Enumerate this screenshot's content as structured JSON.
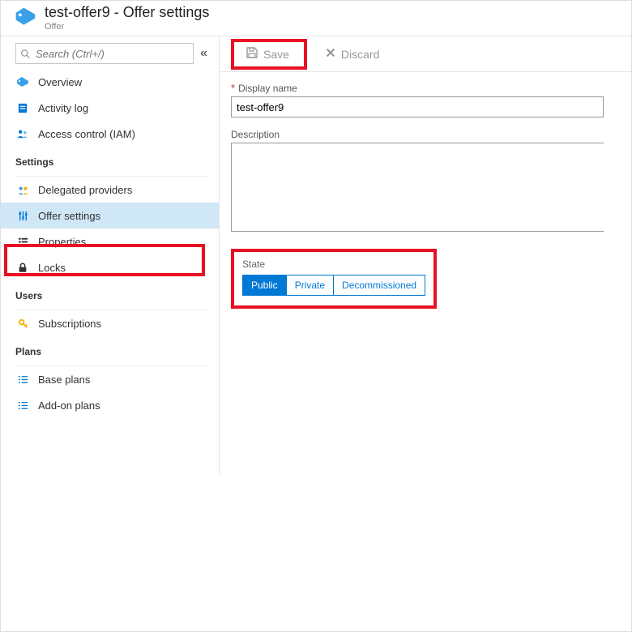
{
  "header": {
    "title": "test-offer9 - Offer settings",
    "subtitle": "Offer"
  },
  "search": {
    "placeholder": "Search (Ctrl+/)"
  },
  "nav": {
    "top": [
      {
        "label": "Overview"
      },
      {
        "label": "Activity log"
      },
      {
        "label": "Access control (IAM)"
      }
    ],
    "settings_label": "Settings",
    "settings": [
      {
        "label": "Delegated providers"
      },
      {
        "label": "Offer settings"
      },
      {
        "label": "Properties"
      },
      {
        "label": "Locks"
      }
    ],
    "users_label": "Users",
    "users": [
      {
        "label": "Subscriptions"
      }
    ],
    "plans_label": "Plans",
    "plans": [
      {
        "label": "Base plans"
      },
      {
        "label": "Add-on plans"
      }
    ]
  },
  "toolbar": {
    "save_label": "Save",
    "discard_label": "Discard"
  },
  "form": {
    "display_name_label": "Display name",
    "display_name_value": "test-offer9",
    "description_label": "Description",
    "description_value": "",
    "state_label": "State",
    "state_options": {
      "public": "Public",
      "private": "Private",
      "decommissioned": "Decommissioned"
    }
  }
}
